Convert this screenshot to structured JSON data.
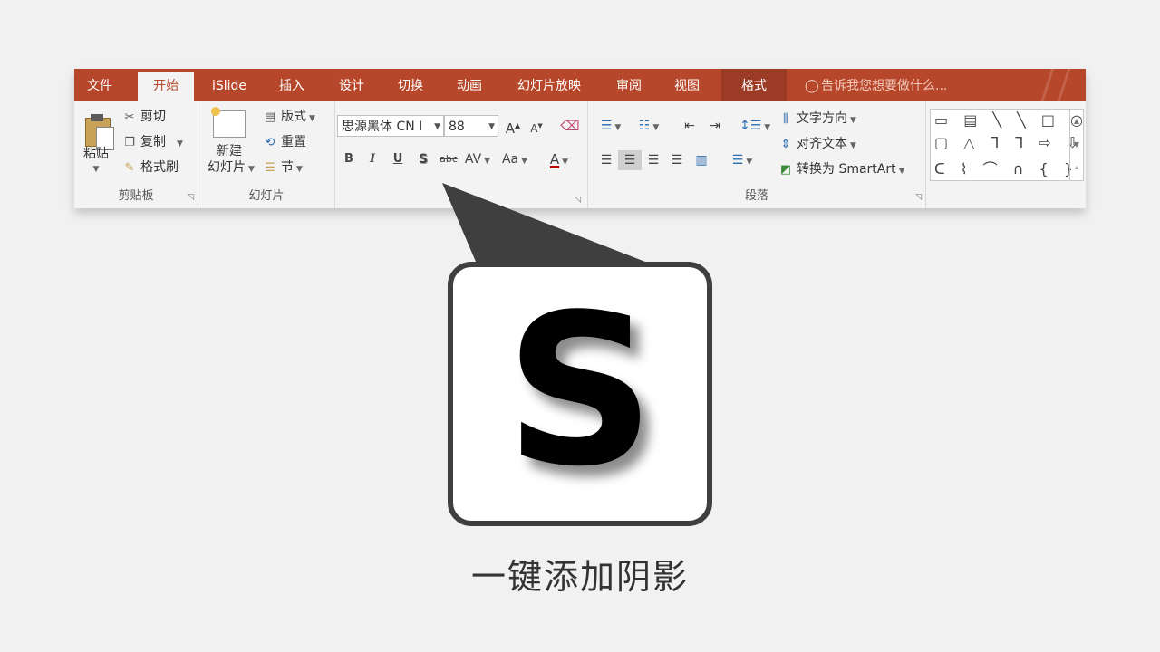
{
  "ribbon": {
    "tabs": [
      {
        "label": "文件",
        "state": "normal"
      },
      {
        "label": "开始",
        "state": "active"
      },
      {
        "label": "iSlide",
        "state": "normal"
      },
      {
        "label": "插入",
        "state": "normal"
      },
      {
        "label": "设计",
        "state": "normal"
      },
      {
        "label": "切换",
        "state": "normal"
      },
      {
        "label": "动画",
        "state": "normal"
      },
      {
        "label": "幻灯片放映",
        "state": "normal"
      },
      {
        "label": "审阅",
        "state": "normal"
      },
      {
        "label": "视图",
        "state": "normal"
      },
      {
        "label": "格式",
        "state": "contextual"
      }
    ],
    "tell_me": "告诉我您想要做什么...",
    "clipboard": {
      "paste": "粘贴",
      "cut": "剪切",
      "copy": "复制",
      "format_painter": "格式刷",
      "label": "剪贴板"
    },
    "slides": {
      "new_slide_line1": "新建",
      "new_slide_line2": "幻灯片",
      "layout": "版式",
      "reset": "重置",
      "section": "节",
      "label": "幻灯片"
    },
    "font": {
      "name": "思源黑体 CN I",
      "size": "88",
      "grow": "A",
      "shrink": "A",
      "bold": "B",
      "italic": "I",
      "underline": "U",
      "shadow": "S",
      "strikethrough": "abc",
      "spacing": "AV",
      "case": "Aa",
      "color": "A"
    },
    "paragraph": {
      "text_direction": "文字方向",
      "align_text": "对齐文本",
      "convert_smartart": "转换为 SmartArt",
      "label": "段落"
    },
    "drawing": {
      "row1": "▭ ▤ ╲ ╲ □ ○",
      "row2": "▢ △ ᒣ ᒣ ⇨ ⇩",
      "row3": "ᑕ ⌇ ⌒ ∩ { }"
    }
  },
  "callout": {
    "key_letter": "S",
    "caption": "一键添加阴影"
  },
  "colors": {
    "tab_bar": "#b7472a",
    "contextual_tab": "#9b3b25",
    "background": "#f1f1f1",
    "key_border": "#3f3f3f"
  }
}
